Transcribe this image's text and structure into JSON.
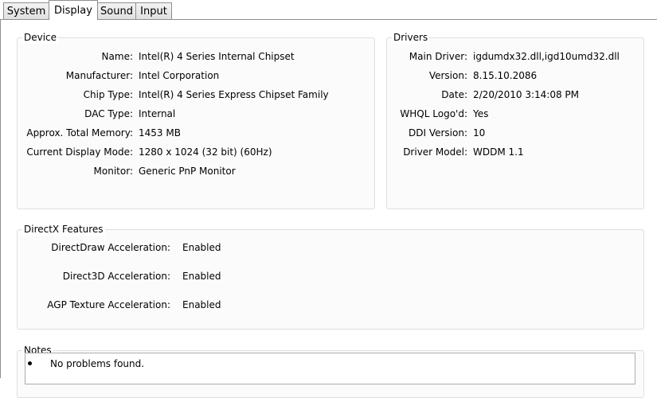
{
  "tabs": [
    {
      "label": "System"
    },
    {
      "label": "Display"
    },
    {
      "label": "Sound"
    },
    {
      "label": "Input"
    }
  ],
  "device": {
    "title": "Device",
    "rows": [
      {
        "label": "Name:",
        "value": "Intel(R) 4 Series Internal Chipset"
      },
      {
        "label": "Manufacturer:",
        "value": "Intel Corporation"
      },
      {
        "label": "Chip Type:",
        "value": "Intel(R) 4 Series Express Chipset Family"
      },
      {
        "label": "DAC Type:",
        "value": "Internal"
      },
      {
        "label": "Approx. Total Memory:",
        "value": "1453 MB"
      },
      {
        "label": "Current Display Mode:",
        "value": "1280 x 1024 (32 bit) (60Hz)"
      },
      {
        "label": "Monitor:",
        "value": "Generic PnP Monitor"
      }
    ]
  },
  "drivers": {
    "title": "Drivers",
    "rows": [
      {
        "label": "Main Driver:",
        "value": "igdumdx32.dll,igd10umd32.dll"
      },
      {
        "label": "Version:",
        "value": "8.15.10.2086"
      },
      {
        "label": "Date:",
        "value": "2/20/2010 3:14:08 PM"
      },
      {
        "label": "WHQL Logo'd:",
        "value": "Yes"
      },
      {
        "label": "DDI Version:",
        "value": "10"
      },
      {
        "label": "Driver Model:",
        "value": "WDDM 1.1"
      }
    ]
  },
  "directx": {
    "title": "DirectX Features",
    "rows": [
      {
        "label": "DirectDraw Acceleration:",
        "value": "Enabled"
      },
      {
        "label": "Direct3D Acceleration:",
        "value": "Enabled"
      },
      {
        "label": "AGP Texture Acceleration:",
        "value": "Enabled"
      }
    ]
  },
  "notes": {
    "title": "Notes",
    "items": [
      "No problems found."
    ]
  }
}
